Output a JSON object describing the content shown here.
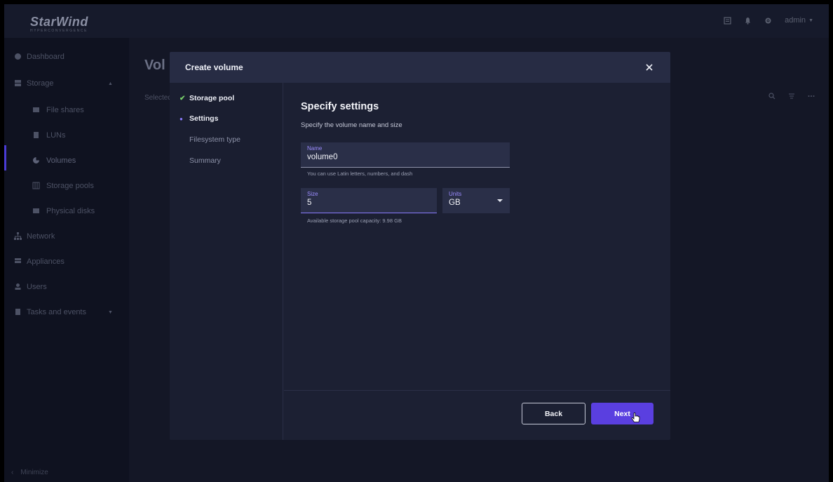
{
  "app": {
    "brand": "StarWind",
    "brand_sub": "HYPERCONVERGENCE",
    "user": "admin",
    "colors": {
      "accent": "#5a3fe0",
      "success": "#7ad36b"
    }
  },
  "sidebar": {
    "items": [
      {
        "label": "Dashboard",
        "icon": "dashboard-icon"
      },
      {
        "label": "Storage",
        "icon": "storage-icon"
      },
      {
        "label": "File shares",
        "icon": "file-shares-icon"
      },
      {
        "label": "LUNs",
        "icon": "luns-icon"
      },
      {
        "label": "Volumes",
        "icon": "volumes-icon"
      },
      {
        "label": "Storage pools",
        "icon": "storage-pools-icon"
      },
      {
        "label": "Physical disks",
        "icon": "physical-disks-icon"
      },
      {
        "label": "Network",
        "icon": "network-icon"
      },
      {
        "label": "Appliances",
        "icon": "appliances-icon"
      },
      {
        "label": "Users",
        "icon": "users-icon"
      },
      {
        "label": "Tasks and events",
        "icon": "tasks-icon"
      }
    ],
    "minimize_label": "Minimize"
  },
  "page": {
    "title": "Vol",
    "selected_text": "Selected"
  },
  "modal": {
    "title": "Create volume",
    "steps": [
      {
        "label": "Storage pool",
        "state": "done"
      },
      {
        "label": "Settings",
        "state": "current"
      },
      {
        "label": "Filesystem type",
        "state": "pending"
      },
      {
        "label": "Summary",
        "state": "pending"
      }
    ],
    "heading": "Specify settings",
    "subheading": "Specify the volume name and size",
    "name_field": {
      "label": "Name",
      "value": "volume0",
      "helper": "You can use Latin letters, numbers, and dash"
    },
    "size_field": {
      "label": "Size",
      "value": "5",
      "helper": "Available storage pool capacity: 9.98 GB"
    },
    "units_field": {
      "label": "Units",
      "value": "GB"
    },
    "back_label": "Back",
    "next_label": "Next"
  }
}
